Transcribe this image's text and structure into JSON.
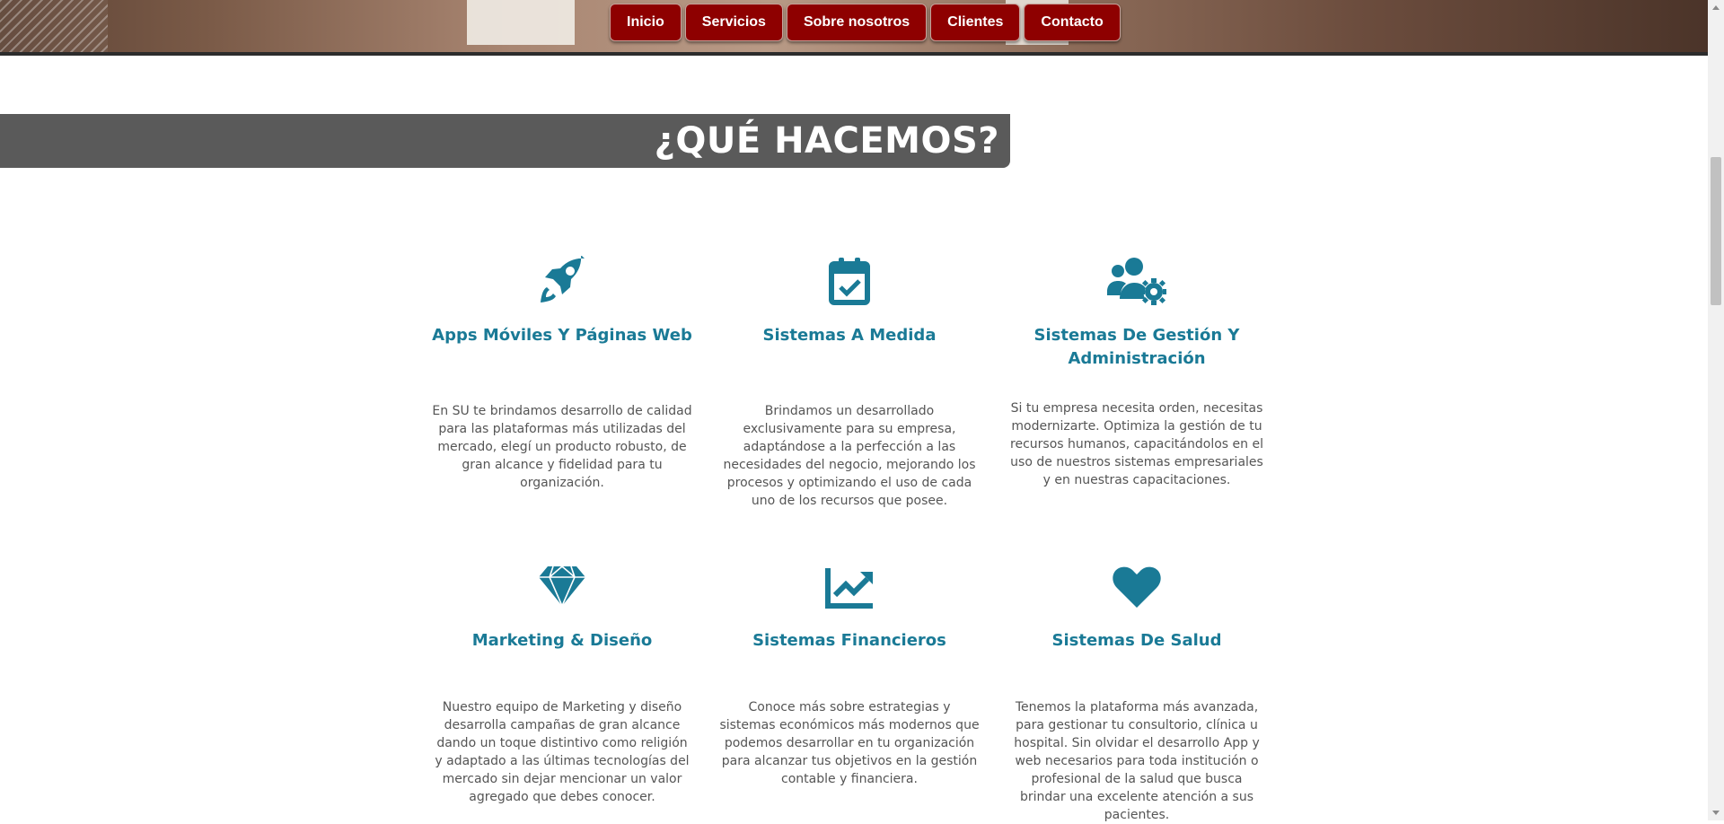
{
  "nav": {
    "items": [
      {
        "label": "Inicio"
      },
      {
        "label": "Servicios"
      },
      {
        "label": "Sobre nosotros"
      },
      {
        "label": "Clientes"
      },
      {
        "label": "Contacto"
      }
    ]
  },
  "section": {
    "title": "¿QUÉ HACEMOS?"
  },
  "colors": {
    "nav_bg": "#8e0000",
    "accent": "#1a7a96",
    "title_bar": "#5a5a5a",
    "body_text": "#555555"
  },
  "services": [
    {
      "icon": "rocket-icon",
      "title": "Apps Móviles Y Páginas Web",
      "text": "En SU te brindamos desarrollo de calidad para las plataformas más utilizadas del mercado, elegí un producto robusto, de gran alcance y fidelidad para tu organización."
    },
    {
      "icon": "calendar-check-icon",
      "title": "Sistemas A Medida",
      "text": "Brindamos un desarrollado exclusivamente para su empresa, adaptándose a la perfección a las necesidades del negocio, mejorando los procesos y optimizando el uso de cada uno de los recursos que posee."
    },
    {
      "icon": "users-gear-icon",
      "title": "Sistemas De Gestión Y Administración",
      "text": "Si tu empresa necesita orden, necesitas modernizarte. Optimiza la gestión de tu recursos humanos, capacitándolos en el uso de nuestros sistemas empresariales y en nuestras capacitaciones."
    },
    {
      "icon": "diamond-icon",
      "title": "Marketing & Diseño",
      "text": "Nuestro equipo de Marketing y diseño desarrolla campañas de gran alcance dando un toque distintivo como religión y adaptado a las últimas tecnologías del mercado sin dejar mencionar un valor agregado que debes conocer."
    },
    {
      "icon": "chart-line-icon",
      "title": "Sistemas Financieros",
      "text": "Conoce más sobre estrategias y sistemas económicos más modernos que podemos desarrollar en tu organización para alcanzar tus objetivos en la gestión contable y financiera."
    },
    {
      "icon": "heart-icon",
      "title": "Sistemas De Salud",
      "text": "Tenemos la plataforma más avanzada, para gestionar tu consultorio, clínica u hospital. Sin olvidar el desarrollo App y web necesarios para toda institución o profesional de la salud que busca brindar una excelente atención a sus pacientes."
    }
  ]
}
